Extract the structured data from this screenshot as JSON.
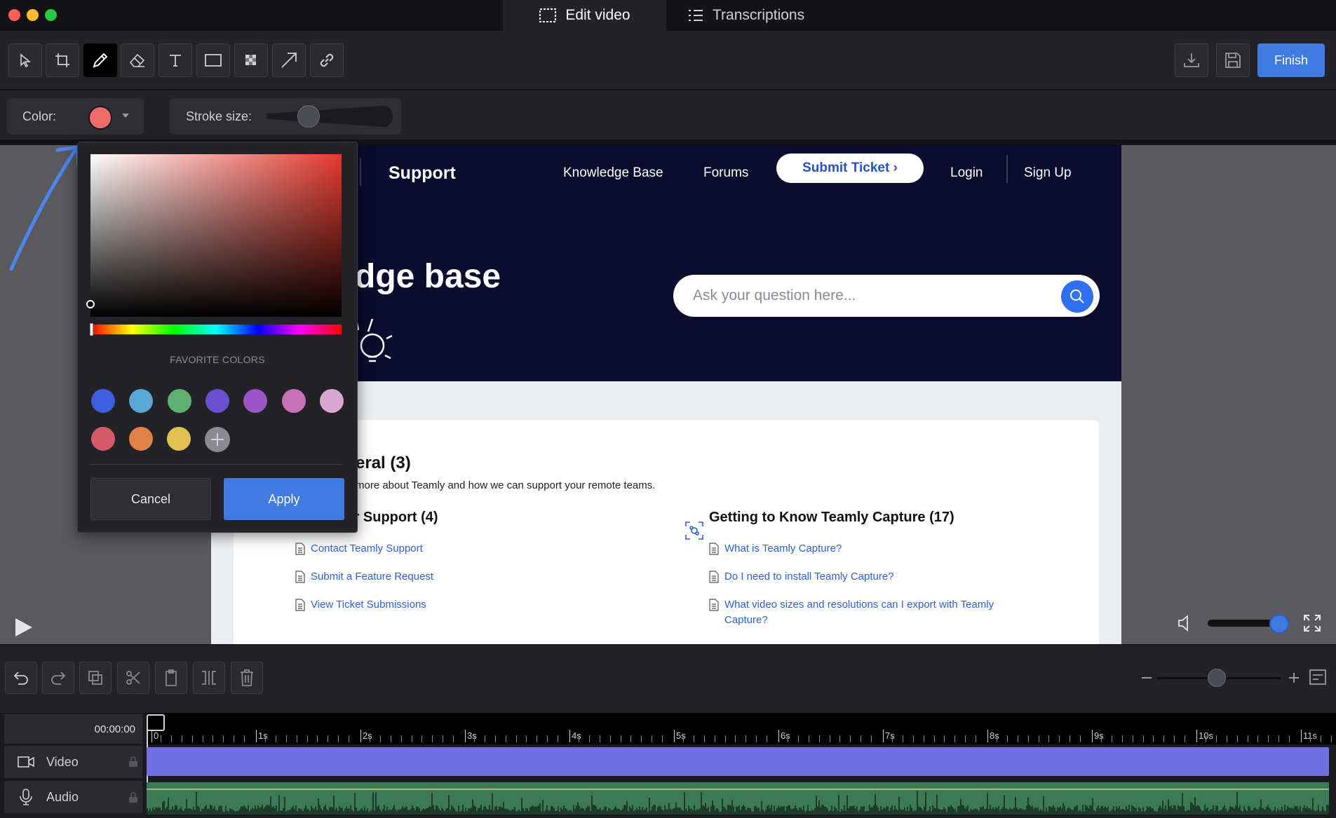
{
  "tabs": {
    "edit": "Edit video",
    "transcriptions": "Transcriptions"
  },
  "toolbar": {
    "finish": "Finish"
  },
  "options": {
    "color_label": "Color:",
    "stroke_label": "Stroke size:",
    "current_color": "#f26b6b"
  },
  "picker": {
    "favorites_label": "FAVORITE COLORS",
    "swatches_row1": [
      "#3f5fe0",
      "#5aa8d8",
      "#5fb070",
      "#6a4fd0",
      "#9a55c8",
      "#c970b8",
      "#d8a8d0"
    ],
    "swatches_row2": [
      "#d45a6a",
      "#e0824a",
      "#e0c050"
    ],
    "cancel": "Cancel",
    "apply": "Apply"
  },
  "site": {
    "brand": "Support",
    "nav": [
      "Knowledge Base",
      "Forums",
      "Submit Ticket ›",
      "Login",
      "Sign Up"
    ],
    "hero_title": "dge base",
    "search_placeholder": "Ask your question here...",
    "section1_title": "eral (3)",
    "section1_desc": "more about Teamly and how we can support your remote teams.",
    "section2_title": "Customer Support (4)",
    "section2_links": [
      "Contact Teamly Support",
      "Submit a Feature Request",
      "View Ticket Submissions"
    ],
    "section3_title": "Getting to Know Teamly Capture (17)",
    "section3_links": [
      "What is Teamly Capture?",
      "Do I need to install Teamly Capture?",
      "What video sizes and resolutions can I export with Teamly",
      "Capture?"
    ]
  },
  "timeline": {
    "time": "00:00:00",
    "ticks": [
      "0",
      "1s",
      "2s",
      "3s",
      "4s",
      "5s",
      "6s",
      "7s",
      "8s",
      "9s",
      "10s",
      "11s"
    ],
    "video_label": "Video",
    "audio_label": "Audio"
  }
}
